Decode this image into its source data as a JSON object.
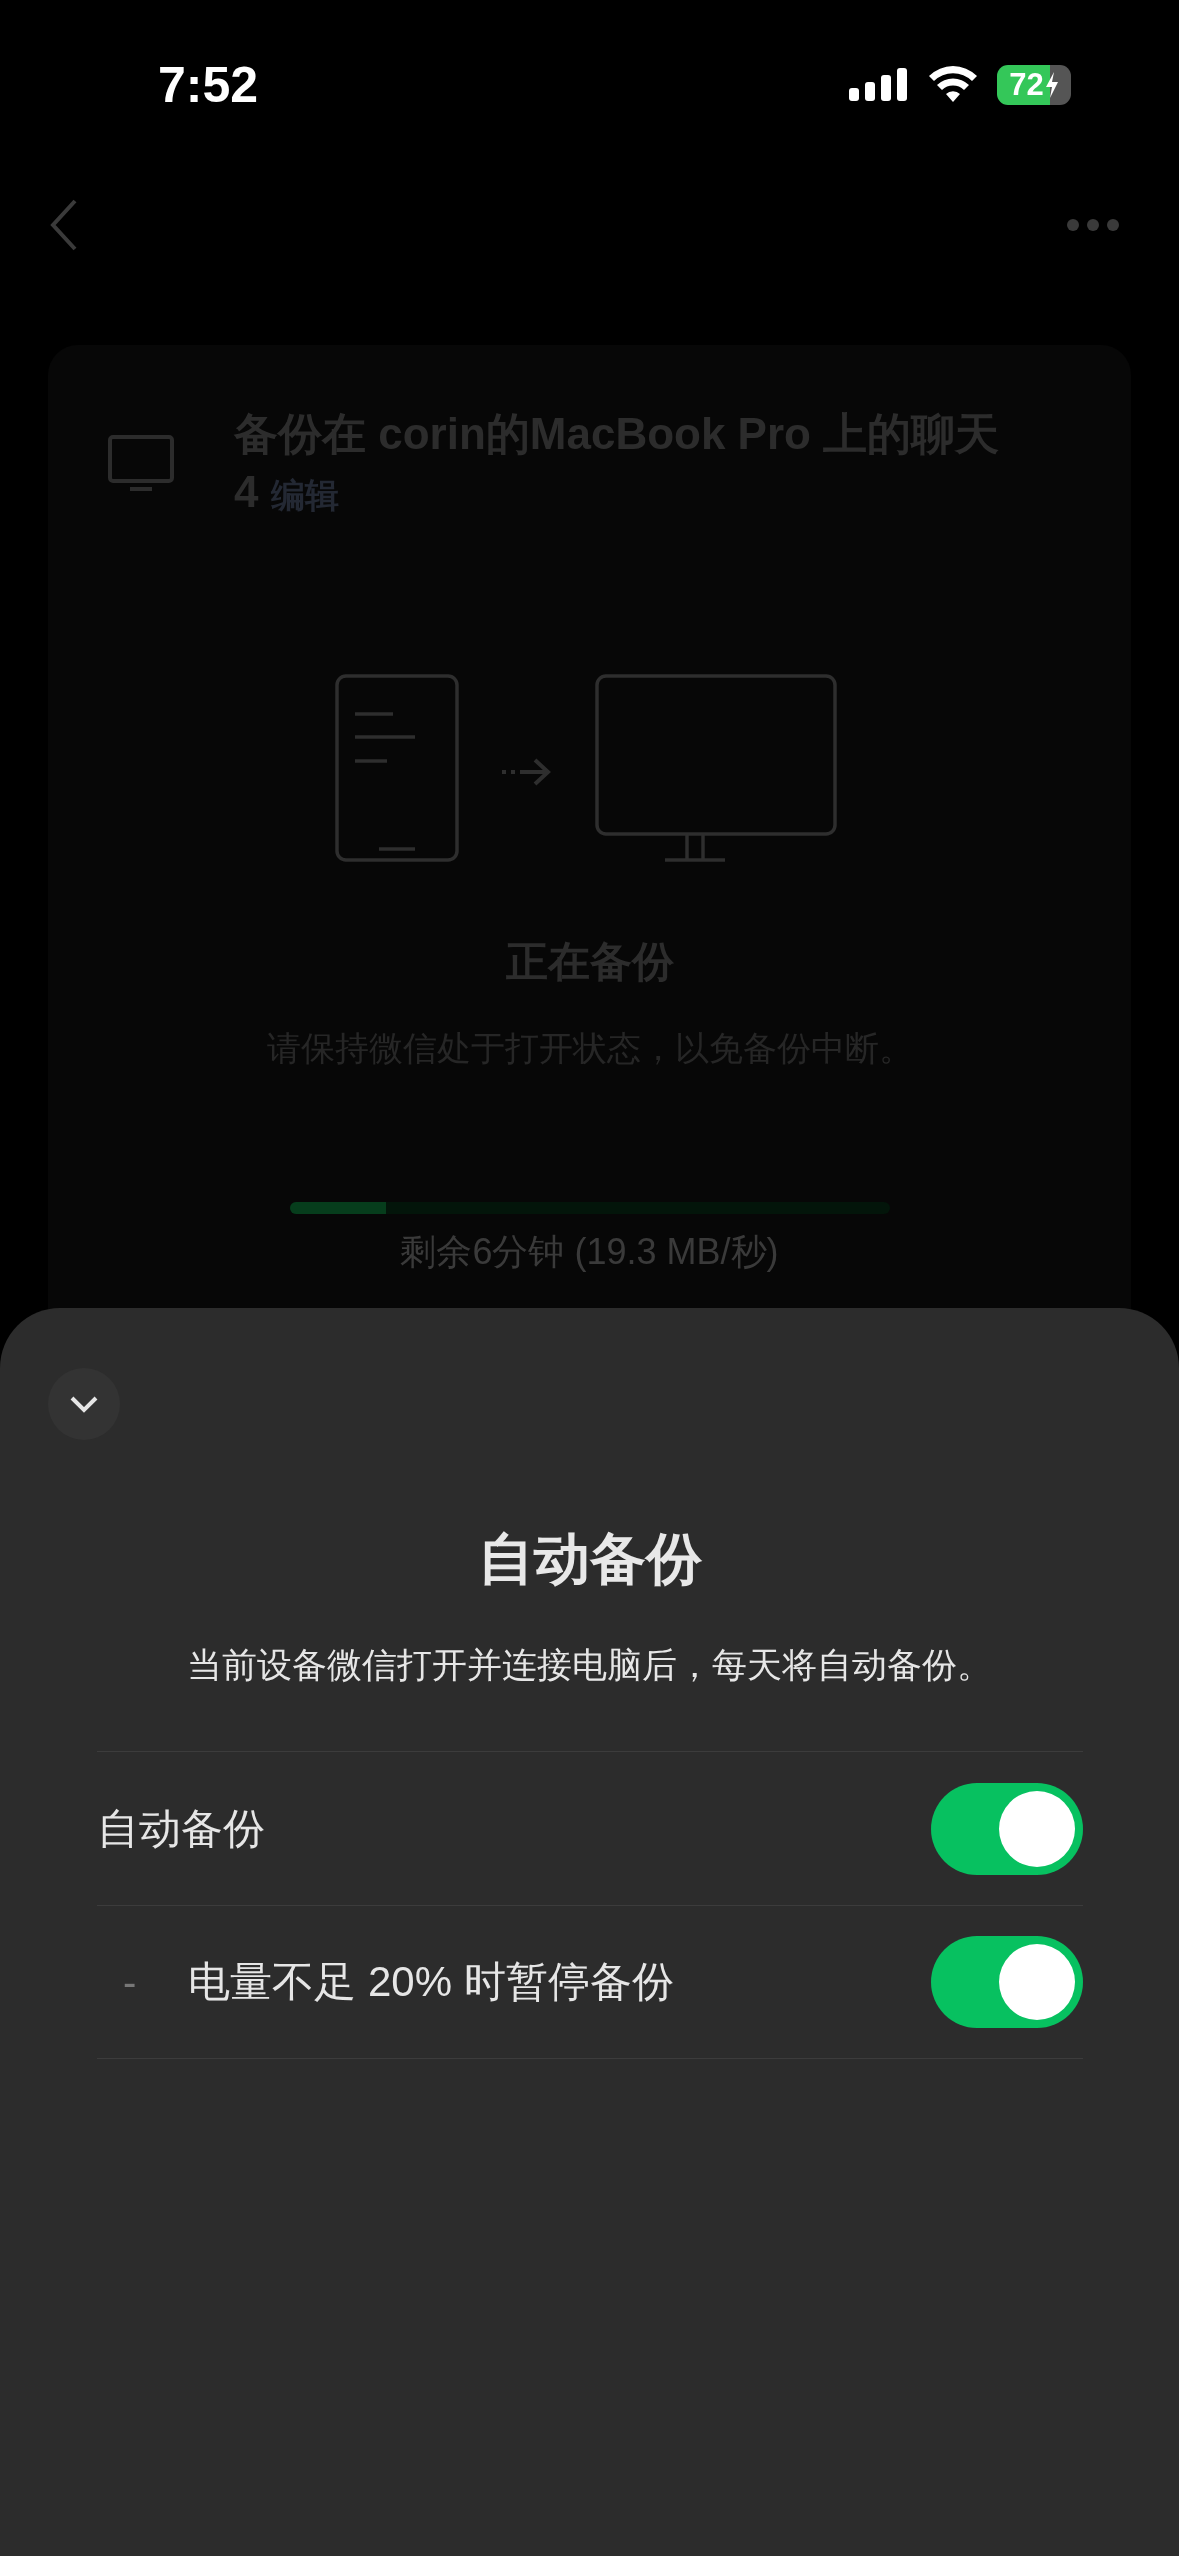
{
  "status_bar": {
    "time": "7:52",
    "battery": "72"
  },
  "backup_card": {
    "title": "备份在 corin的MacBook Pro 上的聊天 4",
    "edit_link": "编辑",
    "status": "正在备份",
    "hint": "请保持微信处于打开状态，以免备份中断。",
    "progress": {
      "level": 0.16
    },
    "remaining": "剩余6分钟 (19.3 MB/秒)"
  },
  "sheet": {
    "title": "自动备份",
    "description": "当前设备微信打开并连接电脑后，每天将自动备份。",
    "rows": [
      {
        "kind": "main",
        "label": "自动备份",
        "on": true
      },
      {
        "kind": "sub",
        "marker": "-",
        "label": "电量不足 20% 时暂停备份",
        "on": true
      }
    ]
  }
}
